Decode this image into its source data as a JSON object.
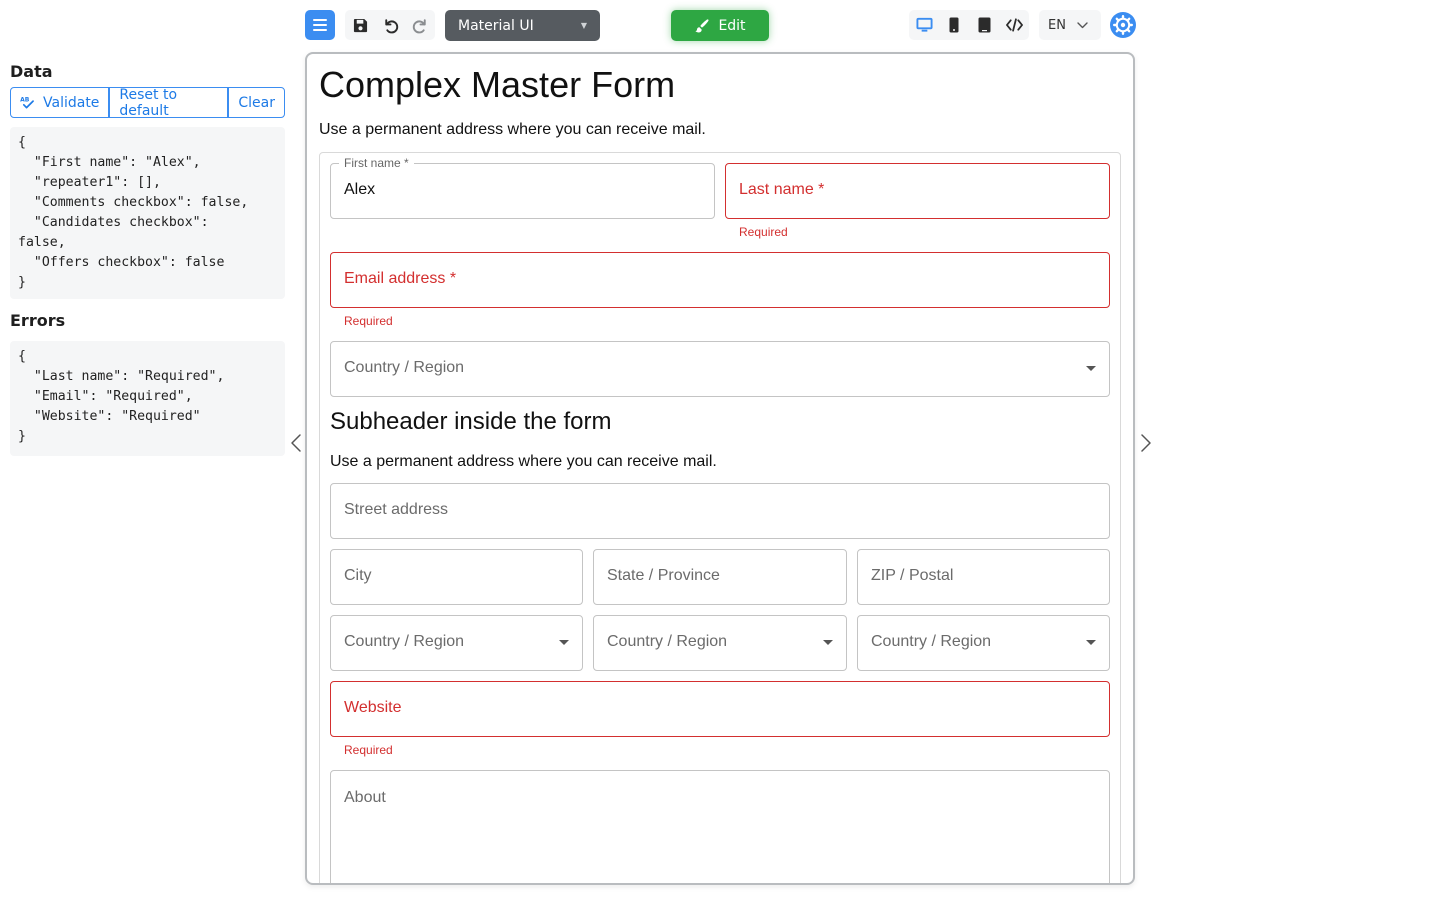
{
  "toolbar": {
    "theme_label": "Material UI",
    "edit_label": "Edit",
    "language": "EN",
    "icons": [
      "menu-icon",
      "save-icon",
      "undo-icon",
      "redo-icon",
      "desktop-icon",
      "phone-icon",
      "tablet-icon",
      "code-icon",
      "gear-icon"
    ]
  },
  "left": {
    "data_title": "Data",
    "validate_label": "Validate",
    "reset_label": "Reset to default",
    "clear_label": "Clear",
    "data_json": "{\n  \"First name\": \"Alex\",\n  \"repeater1\": [],\n  \"Comments checkbox\": false,\n  \"Candidates checkbox\":\nfalse,\n  \"Offers checkbox\": false\n}",
    "errors_title": "Errors",
    "errors_json": "{\n  \"Last name\": \"Required\",\n  \"Email\": \"Required\",\n  \"Website\": \"Required\"\n}"
  },
  "form": {
    "title": "Complex Master Form",
    "description": "Use a permanent address where you can receive mail.",
    "first_name_label": "First name *",
    "first_name_value": "Alex",
    "last_name_label": "Last name *",
    "last_name_error": "Required",
    "email_label": "Email address *",
    "email_error": "Required",
    "country_label": "Country / Region",
    "subheader": "Subheader inside the form",
    "subheader_desc": "Use a permanent address where you can receive mail.",
    "street_label": "Street address",
    "city_label": "City",
    "state_label": "State / Province",
    "zip_label": "ZIP / Postal",
    "country2_label": "Country / Region",
    "country3_label": "Country / Region",
    "country4_label": "Country / Region",
    "website_label": "Website",
    "website_error": "Required",
    "about_label": "About"
  },
  "colors": {
    "accent": "#3b8df1",
    "edit_green": "#2ea743",
    "error_red": "#d32f2f",
    "theme_select_bg": "#565b60"
  }
}
